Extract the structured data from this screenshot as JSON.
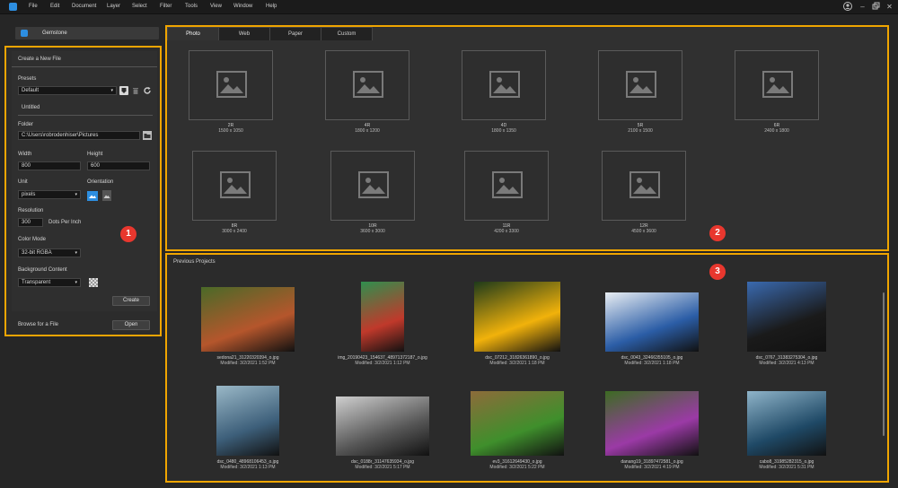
{
  "menu": [
    "File",
    "Edit",
    "Document",
    "Layer",
    "Select",
    "Filter",
    "Tools",
    "View",
    "Window",
    "Help"
  ],
  "window_controls": {
    "account": "user-icon",
    "minimize": "–",
    "restore": "restore-icon",
    "close": "✕"
  },
  "app_tab": "Gemstone",
  "create_panel": {
    "title": "Create a New File",
    "presets_label": "Presets",
    "preset_value": "Default",
    "name_value": "Untitled",
    "folder_label": "Folder",
    "folder_value": "C:\\Users\\robrodenhiser\\Pictures",
    "width_label": "Width",
    "width_value": "800",
    "height_label": "Height",
    "height_value": "600",
    "unit_label": "Unit",
    "unit_value": "pixels",
    "orientation_label": "Orientation",
    "resolution_label": "Resolution",
    "resolution_value": "300",
    "resolution_unit": "Dots Per Inch",
    "color_mode_label": "Color Mode",
    "color_mode_value": "32-bit RGBA",
    "background_label": "Background Content",
    "background_value": "Transparent",
    "create_button": "Create",
    "browse_label": "Browse for a File",
    "open_button": "Open"
  },
  "badges": [
    "1",
    "2",
    "3"
  ],
  "tabs": [
    "Photo",
    "Web",
    "Paper",
    "Custom"
  ],
  "presets": [
    {
      "name": "2R",
      "size": "1500 x 1050"
    },
    {
      "name": "4R",
      "size": "1800 x 1200"
    },
    {
      "name": "4D",
      "size": "1800 x 1350"
    },
    {
      "name": "5R",
      "size": "2100 x 1500"
    },
    {
      "name": "6R",
      "size": "2400 x 1800"
    },
    {
      "name": "8R",
      "size": "3000 x 2400"
    },
    {
      "name": "10R",
      "size": "3600 x 3000"
    },
    {
      "name": "11R",
      "size": "4200 x 3300"
    },
    {
      "name": "12R",
      "size": "4500 x 3600"
    }
  ],
  "projects_title": "Previous Projects",
  "projects": [
    {
      "file": "sedona21_31220320394_o.jpg",
      "modified": "Modified: 3/2/2021 1:52 PM",
      "colors": [
        "#b5562c",
        "#4a6a28"
      ]
    },
    {
      "file": "img_20190423_154637_48971372187_o.jpg",
      "modified": "Modified: 3/2/2021 1:12 PM",
      "colors": [
        "#c0392b",
        "#2f8f4e"
      ]
    },
    {
      "file": "dsc_07212_31826361890_o.jpg",
      "modified": "Modified: 3/2/2021 1:18 PM",
      "colors": [
        "#f1b20b",
        "#1e3a1a"
      ]
    },
    {
      "file": "dsc_0043_32466355105_o.jpg",
      "modified": "Modified: 3/2/2021 1:18 PM",
      "colors": [
        "#2b5da6",
        "#e9eef3"
      ]
    },
    {
      "file": "dsc_0767_31383275304_o.jpg",
      "modified": "Modified: 3/2/2021 4:13 PM",
      "colors": [
        "#1a1a1a",
        "#3a6ab0"
      ]
    },
    {
      "file": "dsc_0480_48968106453_o.jpg",
      "modified": "Modified: 3/2/2021 1:13 PM",
      "colors": [
        "#3d5f7a",
        "#9ab8c7"
      ]
    },
    {
      "file": "dsc_0188r_31147635934_o.jpg",
      "modified": "Modified: 3/2/2021 5:17 PM",
      "colors": [
        "#555555",
        "#cfcfcf"
      ]
    },
    {
      "file": "ev3_31612649430_o.jpg",
      "modified": "Modified: 3/2/2021 5:22 PM",
      "colors": [
        "#3f8f2c",
        "#8d6b3a"
      ]
    },
    {
      "file": "danang19_31897472581_o.jpg",
      "modified": "Modified: 3/2/2021 4:19 PM",
      "colors": [
        "#9b3aa6",
        "#3c6b22"
      ]
    },
    {
      "file": "cabo8_31985282315_o.jpg",
      "modified": "Modified: 3/2/2021 5:31 PM",
      "colors": [
        "#1f4966",
        "#8fb4c9"
      ]
    }
  ],
  "colors": {
    "accent": "#f0a500",
    "badge": "#e8372e",
    "brand": "#2d8ee0"
  }
}
